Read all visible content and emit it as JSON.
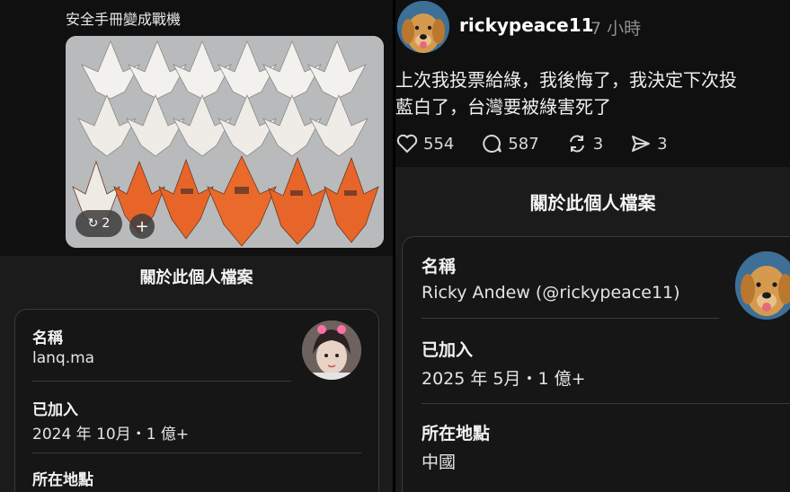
{
  "left": {
    "caption": "安全手冊變成戰機",
    "repost_count": "2",
    "add_label": "+",
    "sheet_title": "關於此個人檔案",
    "fields": {
      "name_label": "名稱",
      "name_value": "lanq.ma",
      "joined_label": "已加入",
      "joined_value": "2024 年 10月・1 億+",
      "location_label": "所在地點"
    }
  },
  "right": {
    "username": "rickypeace11",
    "time": "7 小時",
    "post_line1": "上次我投票給綠，我後悔了，我決定下次投",
    "post_line2": "藍白了，台灣要被綠害死了",
    "likes": "554",
    "comments": "587",
    "reposts": "3",
    "shares": "3",
    "sheet_title": "關於此個人檔案",
    "fields": {
      "name_label": "名稱",
      "name_value": "Ricky Andew (@rickypeace11)",
      "joined_label": "已加入",
      "joined_value": "2025 年 5月・1 億+",
      "location_label": "所在地點",
      "location_value": "中國"
    }
  },
  "colors": {
    "background": "#101010",
    "sheet": "#1b1b1b",
    "plane_orange": "#e8652a",
    "muted_text": "#8f8f8f"
  }
}
